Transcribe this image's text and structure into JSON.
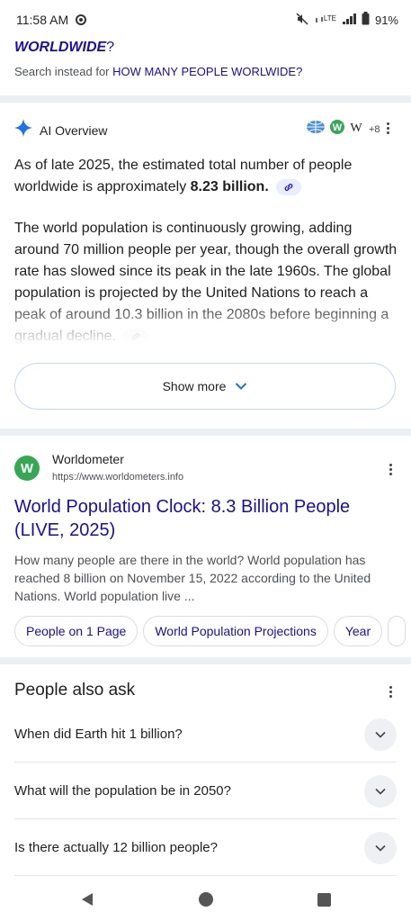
{
  "status_bar": {
    "time": "11:58 AM",
    "battery": "91%",
    "lte": "LTE"
  },
  "did_you_mean": {
    "query": "WORLDWIDE",
    "suffix": "?",
    "instead_prefix": "Search instead for",
    "instead_query": "HOW MANY PEOPLE WORLWIDE?"
  },
  "ai_overview": {
    "title": "AI Overview",
    "source_count": "+8",
    "answer_prefix": "As of late 2025, the estimated total number of people worldwide is approximately ",
    "answer_value": "8.23 billion",
    "answer_suffix": ".",
    "paragraph2": "The world population is continuously growing, adding around 70 million people per year, though the overall growth rate has slowed since its peak in the late 1960s. The global population is projected by the United Nations to reach a peak of around 10.3 billion in the 2080s before beginning a gradual decline.",
    "show_more": "Show more"
  },
  "result": {
    "favicon_letter": "W",
    "site": "Worldometer",
    "url": "https://www.worldometers.info",
    "title": "World Population Clock: 8.3 Billion People (LIVE, 2025)",
    "snippet": "How many people are there in the world? World population has reached 8 billion on November 15, 2022 according to the United Nations. World population live ...",
    "sitelinks": [
      "People on 1 Page",
      "World Population Projections",
      "Year"
    ]
  },
  "people_also_ask": {
    "title": "People also ask",
    "questions": [
      "When did Earth hit 1 billion?",
      "What will the population be in 2050?",
      "Is there actually 12 billion people?"
    ]
  },
  "colors": {
    "link": "#1a0dab",
    "ai_spark": "#1a73e8",
    "favicon": "#34a853",
    "separator": "#eceff3"
  }
}
